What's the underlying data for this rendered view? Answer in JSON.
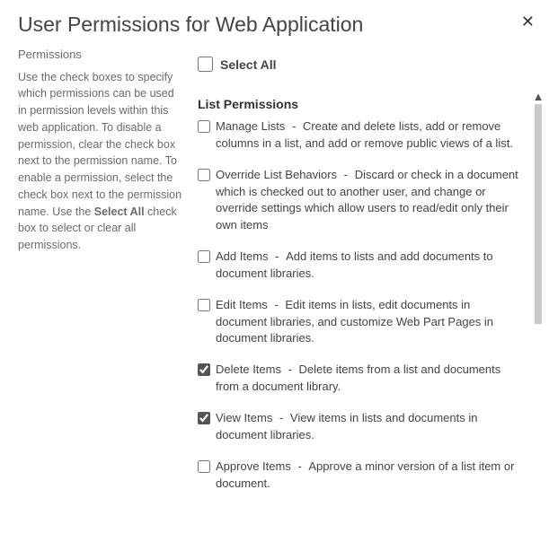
{
  "dialog": {
    "title": "User Permissions for Web Application",
    "close_glyph": "✕"
  },
  "sidebar": {
    "heading": "Permissions",
    "desc_pre": "Use the check boxes to specify which permissions can be used in permission levels within this web application. To disable a permission, clear the check box next to the permission name. To enable a permission, select the check box next to the permission name. Use the ",
    "desc_bold": "Select All",
    "desc_post": " check box to select or clear all permissions."
  },
  "select_all": {
    "label": "Select All",
    "checked": false
  },
  "section_heading": "List Permissions",
  "permissions": [
    {
      "name": "Manage Lists",
      "desc": "Create and delete lists, add or remove columns in a list, and add or remove public views of a list.",
      "checked": false
    },
    {
      "name": "Override List Behaviors",
      "desc": "Discard or check in a document which is checked out to another user, and change or override settings which allow users to read/edit only their own items",
      "checked": false
    },
    {
      "name": "Add Items",
      "desc": "Add items to lists and add documents to document libraries.",
      "checked": false
    },
    {
      "name": "Edit Items",
      "desc": "Edit items in lists, edit documents in document libraries, and customize Web Part Pages in document libraries.",
      "checked": false
    },
    {
      "name": "Delete Items",
      "desc": "Delete items from a list and documents from a document library.",
      "checked": true
    },
    {
      "name": "View Items",
      "desc": "View items in lists and documents in document libraries.",
      "checked": true
    },
    {
      "name": "Approve Items",
      "desc": "Approve a minor version of a list item or document.",
      "checked": false
    }
  ],
  "sep": "  -  "
}
